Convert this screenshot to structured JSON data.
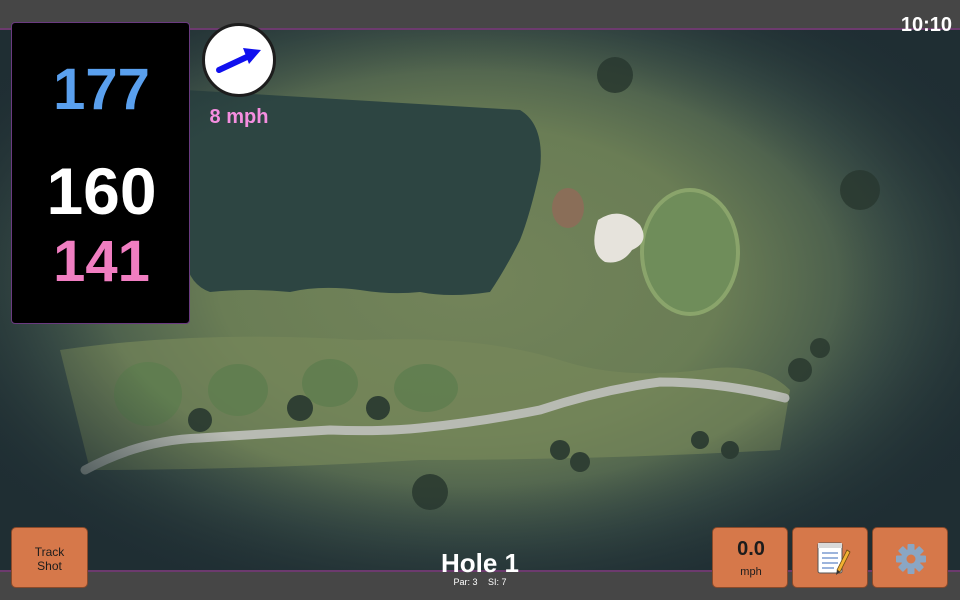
{
  "status": {
    "time": "10:10"
  },
  "distances": {
    "back": "177",
    "middle": "160",
    "front": "141"
  },
  "wind": {
    "speed_label": "8 mph",
    "icon": "wind-direction-arrow-icon"
  },
  "hole": {
    "title": "Hole 1",
    "par_label": "Par: 3",
    "si_label": "SI: 7"
  },
  "buttons": {
    "track_shot_line1": "Track",
    "track_shot_line2": "Shot",
    "speed_value": "0.0",
    "speed_unit": "mph",
    "notes_icon": "notepad-icon",
    "settings_icon": "gear-icon"
  },
  "colors": {
    "back_distance": "#5aa0ee",
    "middle_distance": "#ffffff",
    "front_distance": "#f07ec1",
    "wind_text": "#f58ee0",
    "button_bg": "#d6784a",
    "accent_border": "#6c3a6e"
  }
}
